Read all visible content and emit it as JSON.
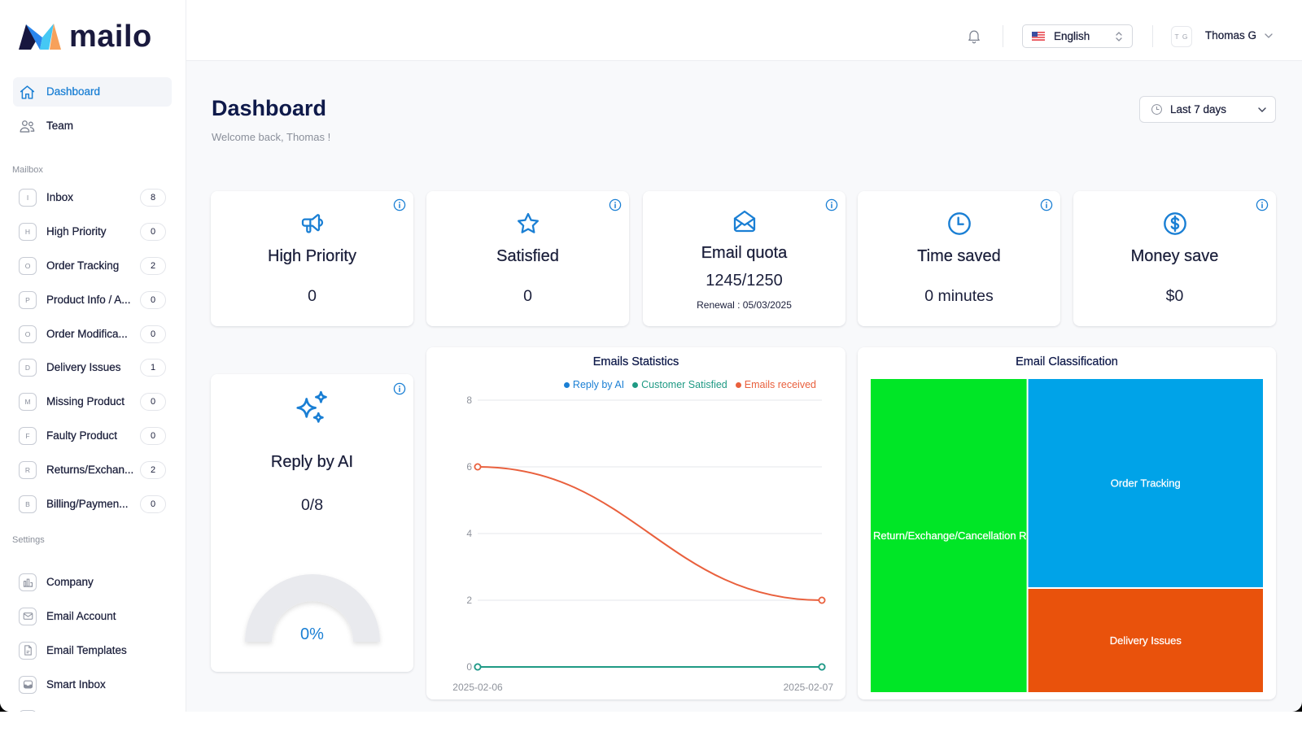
{
  "app": {
    "logo_text": "mailo"
  },
  "sidebar": {
    "nav": [
      {
        "label": "Dashboard",
        "active": true
      },
      {
        "label": "Team",
        "active": false
      }
    ],
    "mailbox_heading": "Mailbox",
    "mailbox": [
      {
        "letter": "I",
        "label": "Inbox",
        "count": "8"
      },
      {
        "letter": "H",
        "label": "High Priority",
        "count": "0"
      },
      {
        "letter": "O",
        "label": "Order Tracking",
        "count": "2"
      },
      {
        "letter": "P",
        "label": "Product Info / A...",
        "count": "0"
      },
      {
        "letter": "O",
        "label": "Order Modifica...",
        "count": "0"
      },
      {
        "letter": "D",
        "label": "Delivery Issues",
        "count": "1"
      },
      {
        "letter": "M",
        "label": "Missing Product",
        "count": "0"
      },
      {
        "letter": "F",
        "label": "Faulty Product",
        "count": "0"
      },
      {
        "letter": "R",
        "label": "Returns/Exchan...",
        "count": "2"
      },
      {
        "letter": "B",
        "label": "Billing/Paymen...",
        "count": "0"
      }
    ],
    "settings_heading": "Settings",
    "settings": [
      {
        "label": "Company",
        "icon": "company-icon"
      },
      {
        "label": "Email Account",
        "icon": "mail-icon"
      },
      {
        "label": "Email Templates",
        "icon": "file-icon"
      },
      {
        "label": "Smart Inbox",
        "icon": "inbox-icon"
      }
    ]
  },
  "header": {
    "language": "English",
    "user_initials": "T G",
    "user_name": "Thomas G"
  },
  "page": {
    "title": "Dashboard",
    "subtitle": "Welcome back, Thomas !",
    "date_range": "Last 7 days"
  },
  "stats": [
    {
      "title": "High Priority",
      "value": "0",
      "icon": "megaphone-icon"
    },
    {
      "title": "Satisfied",
      "value": "0",
      "icon": "star-icon"
    },
    {
      "title": "Email quota",
      "value": "1245/1250",
      "note": "Renewal : 05/03/2025",
      "icon": "mail-open-icon"
    },
    {
      "title": "Time saved",
      "value": "0 minutes",
      "icon": "clock-icon"
    },
    {
      "title": "Money save",
      "value": "$0",
      "icon": "dollar-icon"
    }
  ],
  "reply_ai": {
    "title": "Reply by AI",
    "value": "0/8",
    "gauge_percent": 0,
    "gauge_label": "0%"
  },
  "colors": {
    "accent": "#1a7fd4",
    "text_dark": "#1b1f3b",
    "text_muted": "#8a8f9a",
    "gauge_track": "#e9eaee"
  },
  "chart_data": [
    {
      "type": "line",
      "title": "Emails Statistics",
      "x": [
        "2025-02-06",
        "2025-02-07"
      ],
      "series": [
        {
          "name": "Reply by AI",
          "values": [
            0,
            0
          ],
          "color": "#1a7fd4"
        },
        {
          "name": "Customer Satisfied",
          "values": [
            0,
            0
          ],
          "color": "#1f9a84"
        },
        {
          "name": "Emails received",
          "values": [
            6,
            2
          ],
          "color": "#e9603d"
        }
      ],
      "ylim": [
        0,
        8
      ],
      "y_ticks": [
        0,
        2,
        4,
        6,
        8
      ],
      "xlabel": "",
      "ylabel": "",
      "grid": true,
      "legend": "top-right"
    },
    {
      "type": "treemap",
      "title": "Email Classification",
      "categories": [
        "Product Return/Exchange/Cancellation Requests",
        "Order Tracking",
        "Delivery Issues"
      ],
      "values": [
        2,
        2,
        1
      ],
      "colors": [
        "#00e626",
        "#00a3e8",
        "#e9520c"
      ]
    }
  ]
}
